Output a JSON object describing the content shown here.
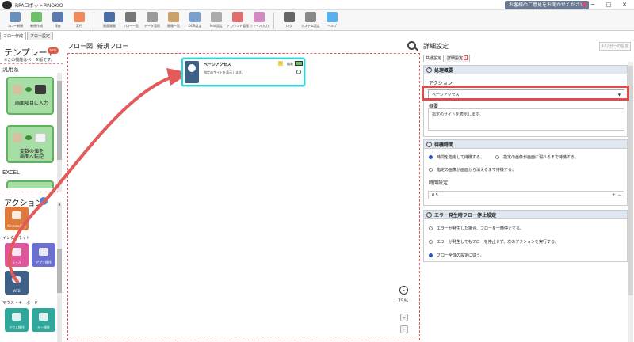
{
  "app": {
    "title": "RPAロボットPINOKIO",
    "feedback_label": "お客様のご意見をお聞かせください",
    "heart": "♥",
    "win_min": "─",
    "win_max": "□",
    "win_close": "✕"
  },
  "colors": {
    "accent": "#3a8be0",
    "highlight": "#e04a4a",
    "selection": "#3ad0d8",
    "green_card": "#a7dea5"
  },
  "ribbon": {
    "buttons": [
      {
        "label": "フロー新規",
        "icon": "new-flow-icon",
        "color": "#6a8fb8"
      },
      {
        "label": "新規作成",
        "icon": "create-icon",
        "color": "#6fbf6a"
      },
      {
        "label": "保存",
        "icon": "save-icon",
        "color": "#5a7ab0"
      },
      {
        "label": "実行",
        "icon": "run-icon",
        "color": "#ef8a5c"
      },
      {
        "label": "画面録画",
        "icon": "record-icon",
        "color": "#4a6ea8"
      },
      {
        "label": "フロー一覧",
        "icon": "list-icon",
        "color": "#777777"
      },
      {
        "label": "データ管理",
        "icon": "data-icon",
        "color": "#999999"
      },
      {
        "label": "画像一覧",
        "icon": "images-icon",
        "color": "#c9a36a"
      },
      {
        "label": "OCR設定",
        "icon": "ocr-icon",
        "color": "#7aa0d0"
      },
      {
        "label": "Mail設定",
        "icon": "mail-icon",
        "color": "#aaaaaa"
      },
      {
        "label": "アカウント管理",
        "icon": "account-icon",
        "color": "#e06e6e"
      },
      {
        "label": "ファイル入力",
        "icon": "file-icon",
        "color": "#d08ac0"
      },
      {
        "label": "ログ",
        "icon": "log-icon",
        "color": "#666666"
      },
      {
        "label": "システム設定",
        "icon": "gear-icon",
        "color": "#888888"
      },
      {
        "label": "ヘルプ",
        "icon": "help-icon",
        "color": "#5ab0e8"
      }
    ]
  },
  "left_tabs": [
    {
      "label": "フロー作成",
      "active": true
    },
    {
      "label": "フロー設定",
      "active": false
    }
  ],
  "palette": {
    "template_head": "テンプレート",
    "beta": "beta",
    "beta_note": "※この機能はベータ版です。",
    "general": "汎用系",
    "card1_text": "画面項目に入力",
    "card2_line1": "変数の値を",
    "card2_line2": "画面へ転記",
    "excel": "EXCEL",
    "action_head": "アクション",
    "help": "?",
    "tile_kintone": "Kintone連携",
    "internet": "インターネット",
    "tile_mail": "メール",
    "tile_app": "アプリ操作",
    "tile_web": "WEB",
    "mouse_kb": "マウス・キーボード",
    "tile_mouse": "マウス操作",
    "tile_key": "キー操作"
  },
  "flow": {
    "title": "フロー図:  新規フロー",
    "node": {
      "title": "ページアクセス",
      "desc": "指定のサイトを表示します。",
      "warn": "!",
      "edit": "編集",
      "chev": "⌄"
    },
    "zoom_up": "︿",
    "zoom": "75%",
    "zoom_in": "+",
    "zoom_out": "-"
  },
  "detail": {
    "title": "詳細設定",
    "trigger": "トリガーの設定",
    "tabs": [
      {
        "label": "共通設定",
        "active": true
      },
      {
        "label": "詳細設定",
        "active": false
      }
    ],
    "tab_mark": "!",
    "basic": {
      "head": "処理概要",
      "action_label": "アクション",
      "action_value": "ページアクセス",
      "caret": "▼",
      "summary_label": "概要",
      "summary_value": "指定のサイトを表示します。"
    },
    "wait": {
      "head": "待機時間",
      "opt1": "時間を指定して待機する。",
      "opt2": "指定の画像が画面に現れるまで待機する。",
      "opt3": "指定の画像が画面から消えるまで待機する。",
      "time_label": "時間設定",
      "time_value": "0.5",
      "pm": "+ −"
    },
    "error": {
      "head": "エラー発生時フロー停止設定",
      "opt1": "エラーが発生した場合、フローを一時停止する。",
      "opt2": "エラーが発生してもフローを停止せず、次のアクションを実行する。",
      "opt3": "フロー全体の設定に従う。"
    }
  }
}
